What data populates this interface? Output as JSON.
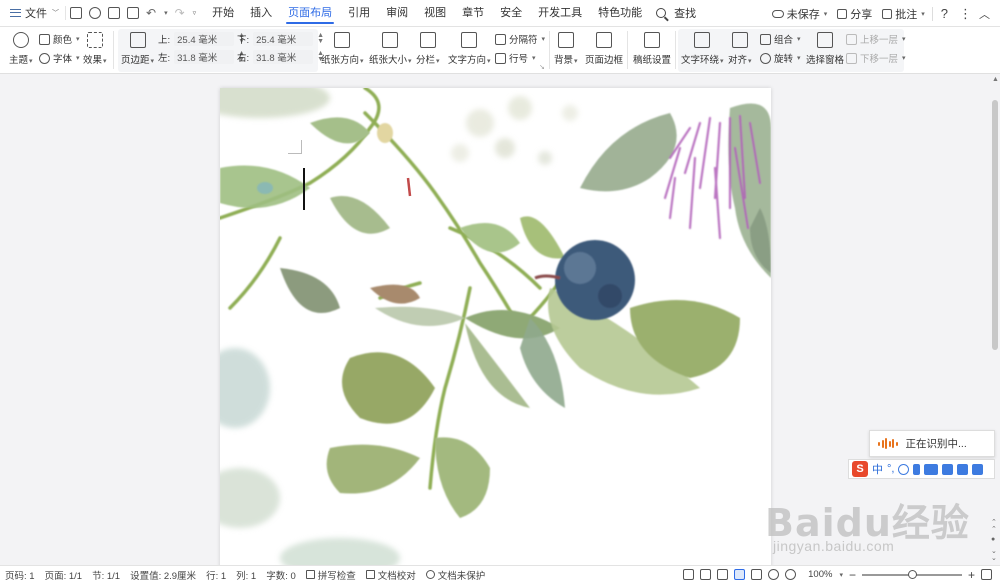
{
  "menubar": {
    "file_label": "文件",
    "undo_icon": "undo-icon",
    "tabs": [
      "开始",
      "插入",
      "页面布局",
      "引用",
      "审阅",
      "视图",
      "章节",
      "安全",
      "开发工具",
      "特色功能"
    ],
    "active_tab": "页面布局",
    "search_label": "查找",
    "unsaved_label": "未保存",
    "share_label": "分享",
    "comment_label": "批注",
    "help_label": "?",
    "more_label": "⋮"
  },
  "ribbon": {
    "theme_label": "主题",
    "color_label": "颜色",
    "font_label": "字体",
    "effect_label": "效果",
    "margins_label": "页边距",
    "margin_top_label": "上:",
    "margin_top_value": "25.4 毫米",
    "margin_bottom_label": "下:",
    "margin_bottom_value": "25.4 毫米",
    "margin_left_label": "左:",
    "margin_left_value": "31.8 毫米",
    "margin_right_label": "右:",
    "margin_right_value": "31.8 毫米",
    "orientation_label": "纸张方向",
    "size_label": "纸张大小",
    "columns_label": "分栏",
    "text_direction_label": "文字方向",
    "breaks_label": "分隔符",
    "line_numbers_label": "行号",
    "background_label": "背景",
    "page_border_label": "页面边框",
    "draft_paper_label": "稿纸设置",
    "wrap_text_label": "文字环绕",
    "align_label": "对齐",
    "group_label": "组合",
    "rotate_label": "旋转",
    "selection_pane_label": "选择窗格",
    "bring_forward_label": "上移一层",
    "send_backward_label": "下移一层"
  },
  "ime": {
    "status_text": "正在识别中...",
    "logo_text": "S",
    "mode_label": "中",
    "punct_label": "°,"
  },
  "watermark": {
    "main_text": "Baidu经验",
    "url_text": "jingyan.baidu.com"
  },
  "statusbar": {
    "page_num": "页码: 1",
    "pages": "页面: 1/1",
    "section": "节: 1/1",
    "position": "设置值: 2.9厘米",
    "row": "行: 1",
    "col": "列: 1",
    "word_count": "字数: 0",
    "spell_check": "拼写检查",
    "doc_proof": "文档校对",
    "doc_protect": "文档未保护",
    "zoom": "100%",
    "zoom_minus": "−",
    "zoom_plus": "+"
  },
  "colors": {
    "accent": "#2e6be6",
    "ime_orange": "#e8731c",
    "ime_red": "#e8482b"
  }
}
